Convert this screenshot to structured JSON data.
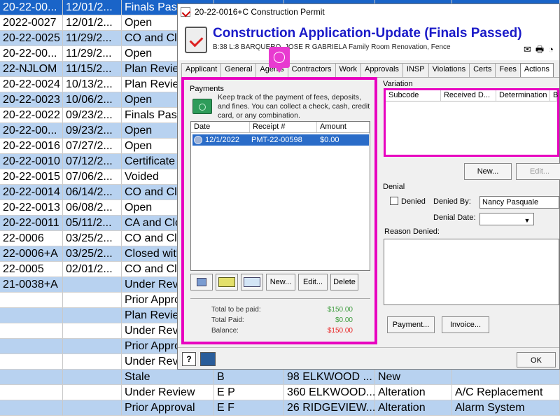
{
  "background": {
    "rows": [
      {
        "c1": "20-22-00...",
        "c2": "12/01/2...",
        "c3": "Finals Pass",
        "selected": true
      },
      {
        "c1": "2022-0027",
        "c2": "12/01/2...",
        "c3": "Open"
      },
      {
        "c1": "20-22-0025",
        "c2": "11/29/2...",
        "c3": "CO and Clo"
      },
      {
        "c1": "20-22-00...",
        "c2": "11/29/2...",
        "c3": "Open"
      },
      {
        "c1": "22-NJLOM",
        "c2": "11/15/2...",
        "c3": "Plan Review"
      },
      {
        "c1": "20-22-0024",
        "c2": "10/13/2...",
        "c3": "Plan Review"
      },
      {
        "c1": "20-22-0023",
        "c2": "10/06/2...",
        "c3": "Open"
      },
      {
        "c1": "20-22-0022",
        "c2": "09/23/2...",
        "c3": "Finals Pass"
      },
      {
        "c1": "20-22-00...",
        "c2": "09/23/2...",
        "c3": "Open"
      },
      {
        "c1": "20-22-0016",
        "c2": "07/27/2...",
        "c3": "Open"
      },
      {
        "c1": "20-22-0010",
        "c2": "07/12/2...",
        "c3": "Certificate"
      },
      {
        "c1": "20-22-0015",
        "c2": "07/06/2...",
        "c3": "Voided"
      },
      {
        "c1": "20-22-0014",
        "c2": "06/14/2...",
        "c3": "CO and Clo"
      },
      {
        "c1": "20-22-0013",
        "c2": "06/08/2...",
        "c3": "Open"
      },
      {
        "c1": "20-22-0011",
        "c2": "05/11/2...",
        "c3": "CA and Clo"
      },
      {
        "c1": "22-0006",
        "c2": "03/25/2...",
        "c3": "CO and Clo"
      },
      {
        "c1": "22-0006+A",
        "c2": "03/25/2...",
        "c3": "Closed with"
      },
      {
        "c1": "22-0005",
        "c2": "02/01/2...",
        "c3": "CO and Clo"
      },
      {
        "c1": "21-0038+A",
        "c2": "",
        "c3": "Under Revie"
      },
      {
        "c1": "",
        "c2": "",
        "c3": "Prior Appro"
      },
      {
        "c1": "",
        "c2": "",
        "c3": "Plan Review"
      },
      {
        "c1": "",
        "c2": "",
        "c3": "Under Revie"
      },
      {
        "c1": "",
        "c2": "",
        "c3": "Prior Appro"
      },
      {
        "c1": "",
        "c2": "",
        "c3": "Under Revie"
      },
      {
        "c1": "",
        "c2": "",
        "c3": "Stale",
        "c4": "B",
        "c5": "98 ELKWOOD ...",
        "c6": "New",
        "c7": ""
      },
      {
        "c1": "",
        "c2": "",
        "c3": "Under Review",
        "c4": "E P",
        "c5": "360 ELKWOOD...",
        "c6": "Alteration",
        "c7": "A/C Replacement"
      },
      {
        "c1": "",
        "c2": "",
        "c3": "Prior Approval",
        "c4": "E F",
        "c5": "26 RIDGEVIEW...",
        "c6": "Alteration",
        "c7": "Alarm System"
      }
    ]
  },
  "dialog": {
    "window_title": "20-22-0016+C Construction Permit",
    "header_title": "Construction Application-Update (Finals Passed)",
    "header_sub": "B:38 L:8  BARQUERO, JOSE R  GABRIELA Family Room Renovation, Fence",
    "tabs": [
      "Applicant",
      "General",
      "Agents",
      "Contractors",
      "Work",
      "Approvals",
      "INSP",
      "Violations",
      "Certs",
      "Fees",
      "Actions"
    ],
    "active_tab": "Actions",
    "payments": {
      "group_label": "Payments",
      "description": "Keep track of the payment of fees, deposits, and fines. You can collect a check, cash, credit card, or any combination.",
      "columns": [
        "Date",
        "Receipt #",
        "Amount"
      ],
      "rows": [
        {
          "date": "12/1/2022",
          "receipt": "PMT-22-00598",
          "amount": "$0.00"
        }
      ],
      "buttons": {
        "new": "New...",
        "edit": "Edit...",
        "delete": "Delete"
      },
      "totals": {
        "to_be_paid_label": "Total to be paid:",
        "to_be_paid": "$150.00",
        "paid_label": "Total Paid:",
        "paid": "$0.00",
        "balance_label": "Balance:",
        "balance": "$150.00"
      }
    },
    "variation": {
      "group_label": "Variation",
      "columns": [
        "Subcode",
        "Received D...",
        "Determination",
        "B"
      ],
      "buttons": {
        "new": "New...",
        "edit": "Edit..."
      }
    },
    "denial": {
      "group_label": "Denial",
      "denied_label": "Denied",
      "denied_by_label": "Denied By:",
      "denied_by_value": "Nancy Pasquale",
      "denial_date_label": "Denial Date:",
      "denial_date_value": "",
      "reason_label": "Reason Denied:",
      "reason_value": ""
    },
    "bottom_buttons": {
      "payment": "Payment...",
      "invoice": "Invoice...",
      "ok": "OK",
      "help": "?"
    }
  },
  "colors": {
    "highlight": "#e800c0",
    "title": "#1a1ac8",
    "selection": "#2a6cc8",
    "green": "#3c9c3c",
    "red": "#e82020"
  }
}
